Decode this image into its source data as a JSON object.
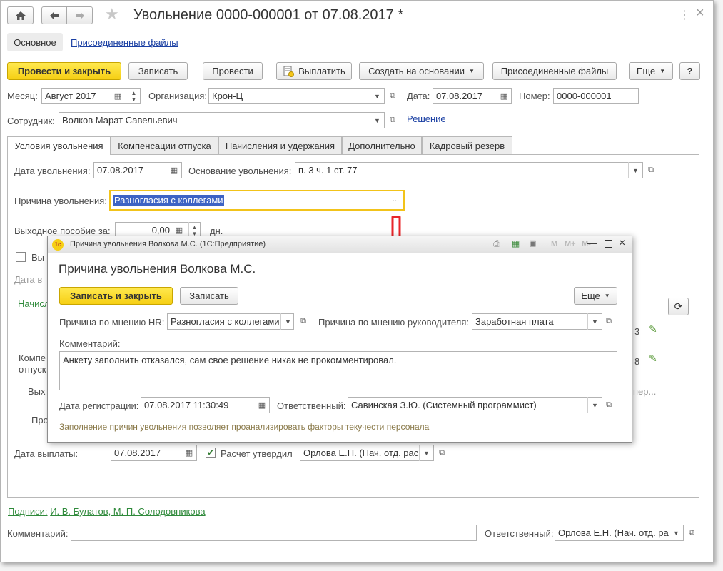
{
  "header": {
    "title": "Увольнение 0000-000001 от 07.08.2017 *",
    "home_icon": "home-icon",
    "back_icon": "arrow-left-icon",
    "forward_icon": "arrow-right-icon",
    "star": "★",
    "menu_dots": "⋮",
    "close": "×"
  },
  "nav_tabs": {
    "main": "Основное",
    "files": "Присоединенные файлы"
  },
  "toolbar": {
    "post_close": "Провести и закрыть",
    "save": "Записать",
    "post": "Провести",
    "pay": "Выплатить",
    "create_based": "Создать на основании",
    "attached_files": "Присоединенные файлы",
    "more": "Еще",
    "help": "?"
  },
  "form": {
    "month_label": "Месяц:",
    "month_value": "Август 2017",
    "org_label": "Организация:",
    "org_value": "Крон-Ц",
    "date_label": "Дата:",
    "date_value": "07.08.2017",
    "number_label": "Номер:",
    "number_value": "0000-000001",
    "employee_label": "Сотрудник:",
    "employee_value": "Волков Марат Савельевич",
    "decision_link": "Решение"
  },
  "tabs": [
    "Условия увольнения",
    "Компенсации отпуска",
    "Начисления и удержания",
    "Дополнительно",
    "Кадровый резерв"
  ],
  "conditions": {
    "dismissal_date_label": "Дата увольнения:",
    "dismissal_date_value": "07.08.2017",
    "basis_label": "Основание увольнения:",
    "basis_value": "п. 3 ч. 1 ст. 77",
    "reason_label": "Причина увольнения:",
    "reason_value": "Разногласия с коллегами",
    "reason_btn": "...",
    "severance_label": "Выходное пособие за:",
    "severance_value": "0,00",
    "severance_unit": "дн.",
    "checkbox_label_partial": "Вы",
    "date_partial": "Дата в",
    "accruals_partial": "Начисл",
    "comp_partial_1": "Компе",
    "comp_partial_2": "отпуск",
    "out_partial": "Вых",
    "pr_partial": "Про",
    "right_field_1": "3",
    "right_field_2": "8",
    "right_text": "пер...",
    "payment_date_label": "Дата выплаты:",
    "payment_date_value": "07.08.2017",
    "calc_approved_label": "Расчет утвердил",
    "calc_approved_value": "Орлова Е.Н. (Нач. отд. рас"
  },
  "footer": {
    "signatures_prefix": "Подписи:",
    "signatures_value": "И. В. Булатов, М. П. Солодовникова",
    "comment_label": "Комментарий:",
    "comment_value": "",
    "responsible_label": "Ответственный:",
    "responsible_value": "Орлова Е.Н. (Нач. отд. ра"
  },
  "dialog": {
    "window_title": "Причина увольнения Волкова М.С. (1С:Предприятие)",
    "logo": "1с",
    "heading": "Причина увольнения Волкова М.С.",
    "save_close": "Записать и закрыть",
    "save": "Записать",
    "more": "Еще",
    "hr_reason_label": "Причина по мнению HR:",
    "hr_reason_value": "Разногласия с коллегами",
    "manager_reason_label": "Причина по мнению руководителя:",
    "manager_reason_value": "Заработная плата",
    "comment_label": "Комментарий:",
    "comment_value": "Анкету заполнить отказался, сам свое решение никак не прокомментировал.",
    "reg_date_label": "Дата регистрации:",
    "reg_date_value": "07.08.2017 11:30:49",
    "responsible_label": "Ответственный:",
    "responsible_value": "Савинская З.Ю. (Системный программист)",
    "hint": "Заполнение причин увольнения позволяет проанализировать факторы текучести персонала",
    "tb_m": "M",
    "tb_mplus": "M+",
    "tb_mminus": "M-"
  },
  "colors": {
    "primary_button": "#f6cf14",
    "link_blue": "#1a3fa3",
    "link_green": "#2f8a3b",
    "arrow_red": "#e8262a"
  }
}
